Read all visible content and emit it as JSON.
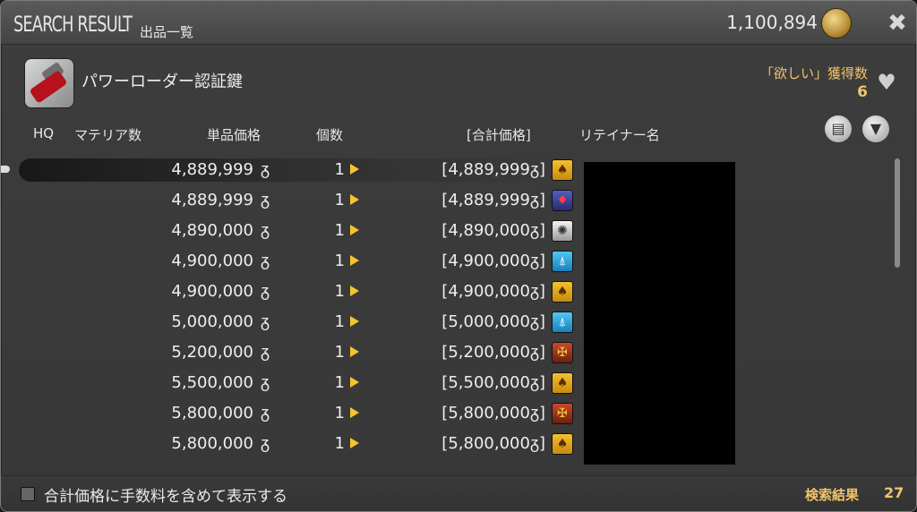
{
  "window": {
    "title": "SEARCH RESULT",
    "subtitle": "出品一覧",
    "gil": "1,100,894"
  },
  "item": {
    "name": "パワーローダー認証鍵",
    "wish_label": "「欲しい」獲得数",
    "wish_count": "6"
  },
  "columns": {
    "hq": "HQ",
    "materia": "マテリア数",
    "unit_price": "単品価格",
    "quantity": "個数",
    "total": "[合計価格]",
    "retainer": "リテイナー名"
  },
  "currency_symbol": "ᵹ",
  "listings": [
    {
      "price": "4,889,999",
      "qty": "1",
      "total": "[4,889,999",
      "world_icon": "gold-emblem-icon",
      "world_class": "w-gold",
      "glyph": "♠"
    },
    {
      "price": "4,889,999",
      "qty": "1",
      "total": "[4,889,999",
      "world_icon": "purple-emblem-icon",
      "world_class": "w-purple",
      "glyph": "♦"
    },
    {
      "price": "4,890,000",
      "qty": "1",
      "total": "[4,890,000",
      "world_icon": "swirl-emblem-icon",
      "world_class": "w-white",
      "glyph": "✺"
    },
    {
      "price": "4,900,000",
      "qty": "1",
      "total": "[4,900,000",
      "world_icon": "tower-emblem-icon",
      "world_class": "w-blue",
      "glyph": "⍋"
    },
    {
      "price": "4,900,000",
      "qty": "1",
      "total": "[4,900,000",
      "world_icon": "gold-emblem-icon",
      "world_class": "w-gold",
      "glyph": "♠"
    },
    {
      "price": "5,000,000",
      "qty": "1",
      "total": "[5,000,000",
      "world_icon": "tower-emblem-icon",
      "world_class": "w-blue",
      "glyph": "⍋"
    },
    {
      "price": "5,200,000",
      "qty": "1",
      "total": "[5,200,000",
      "world_icon": "red-emblem-icon",
      "world_class": "w-red",
      "glyph": "✠"
    },
    {
      "price": "5,500,000",
      "qty": "1",
      "total": "[5,500,000",
      "world_icon": "gold-emblem-icon",
      "world_class": "w-gold",
      "glyph": "♠"
    },
    {
      "price": "5,800,000",
      "qty": "1",
      "total": "[5,800,000",
      "world_icon": "red-emblem-icon",
      "world_class": "w-red",
      "glyph": "✠"
    },
    {
      "price": "5,800,000",
      "qty": "1",
      "total": "[5,800,000",
      "world_icon": "gold-emblem-icon",
      "world_class": "w-gold",
      "glyph": "♠"
    }
  ],
  "footer": {
    "checkbox_label": "合計価格に手数料を含めて表示する",
    "result_label": "検索結果",
    "result_count": "27"
  }
}
